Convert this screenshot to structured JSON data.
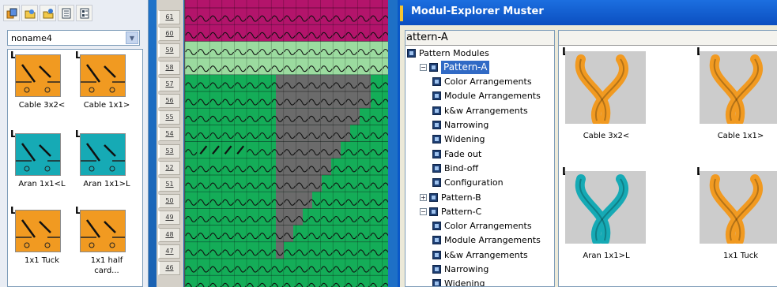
{
  "colors": {
    "magenta": "#b3146b",
    "light_green": "#9bdb9f",
    "green": "#14ad58",
    "gray": "#6b6b6b",
    "orange": "#f19a21",
    "teal": "#16aab5",
    "title_blue": "#0b4ec0"
  },
  "toolbar": {
    "icons": [
      "modules-icon",
      "folder-star-icon",
      "folder-add-icon",
      "list-icon",
      "grid-icon"
    ]
  },
  "library": {
    "selected": "noname4",
    "tiles": [
      {
        "label": "Cable 3x2<",
        "bg": "orange",
        "prefix": "L"
      },
      {
        "label": "Cable 1x1>",
        "bg": "orange",
        "prefix": "L"
      },
      {
        "label": "Aran 1x1<L",
        "bg": "teal",
        "prefix": "L"
      },
      {
        "label": "Aran 1x1>L",
        "bg": "teal",
        "prefix": "L"
      },
      {
        "label": "1x1 Tuck",
        "bg": "orange",
        "prefix": "L"
      },
      {
        "label": "1x1 half\ncard...",
        "bg": "orange",
        "prefix": "L"
      }
    ]
  },
  "row_numbers": [
    "61",
    "60",
    "59",
    "58",
    "57",
    "56",
    "55",
    "54",
    "53",
    "52",
    "51",
    "50",
    "49",
    "48",
    "47",
    "46"
  ],
  "explorer": {
    "title": "Modul-Explorer Muster",
    "tree_header": "attern-A",
    "tree": [
      {
        "label": "Pattern Modules",
        "indent": 0,
        "pm": "",
        "selected": false
      },
      {
        "label": "Pattern-A",
        "indent": 1,
        "pm": "−",
        "selected": true
      },
      {
        "label": "Color Arrangements",
        "indent": 2,
        "pm": "",
        "selected": false
      },
      {
        "label": "Module Arrangements",
        "indent": 2,
        "pm": "",
        "selected": false
      },
      {
        "label": "k&w Arrangements",
        "indent": 2,
        "pm": "",
        "selected": false
      },
      {
        "label": "Narrowing",
        "indent": 2,
        "pm": "",
        "selected": false
      },
      {
        "label": "Widening",
        "indent": 2,
        "pm": "",
        "selected": false
      },
      {
        "label": "Fade out",
        "indent": 2,
        "pm": "",
        "selected": false
      },
      {
        "label": "Bind-off",
        "indent": 2,
        "pm": "",
        "selected": false
      },
      {
        "label": "Configuration",
        "indent": 2,
        "pm": "",
        "selected": false
      },
      {
        "label": "Pattern-B",
        "indent": 1,
        "pm": "+",
        "selected": false
      },
      {
        "label": "Pattern-C",
        "indent": 1,
        "pm": "−",
        "selected": false
      },
      {
        "label": "Color Arrangements",
        "indent": 2,
        "pm": "",
        "selected": false
      },
      {
        "label": "Module Arrangements",
        "indent": 2,
        "pm": "",
        "selected": false
      },
      {
        "label": "k&w Arrangements",
        "indent": 2,
        "pm": "",
        "selected": false
      },
      {
        "label": "Narrowing",
        "indent": 2,
        "pm": "",
        "selected": false
      },
      {
        "label": "Widening",
        "indent": 2,
        "pm": "",
        "selected": false
      }
    ],
    "gallery": [
      {
        "label": "Cable 3x2<",
        "color": "orange",
        "prefix": "L"
      },
      {
        "label": "Cable 1x1>",
        "color": "orange",
        "prefix": "L"
      },
      {
        "label": "Aran 1x1>L",
        "color": "teal",
        "prefix": "L"
      },
      {
        "label": "1x1 Tuck",
        "color": "orange",
        "prefix": "L"
      }
    ]
  }
}
